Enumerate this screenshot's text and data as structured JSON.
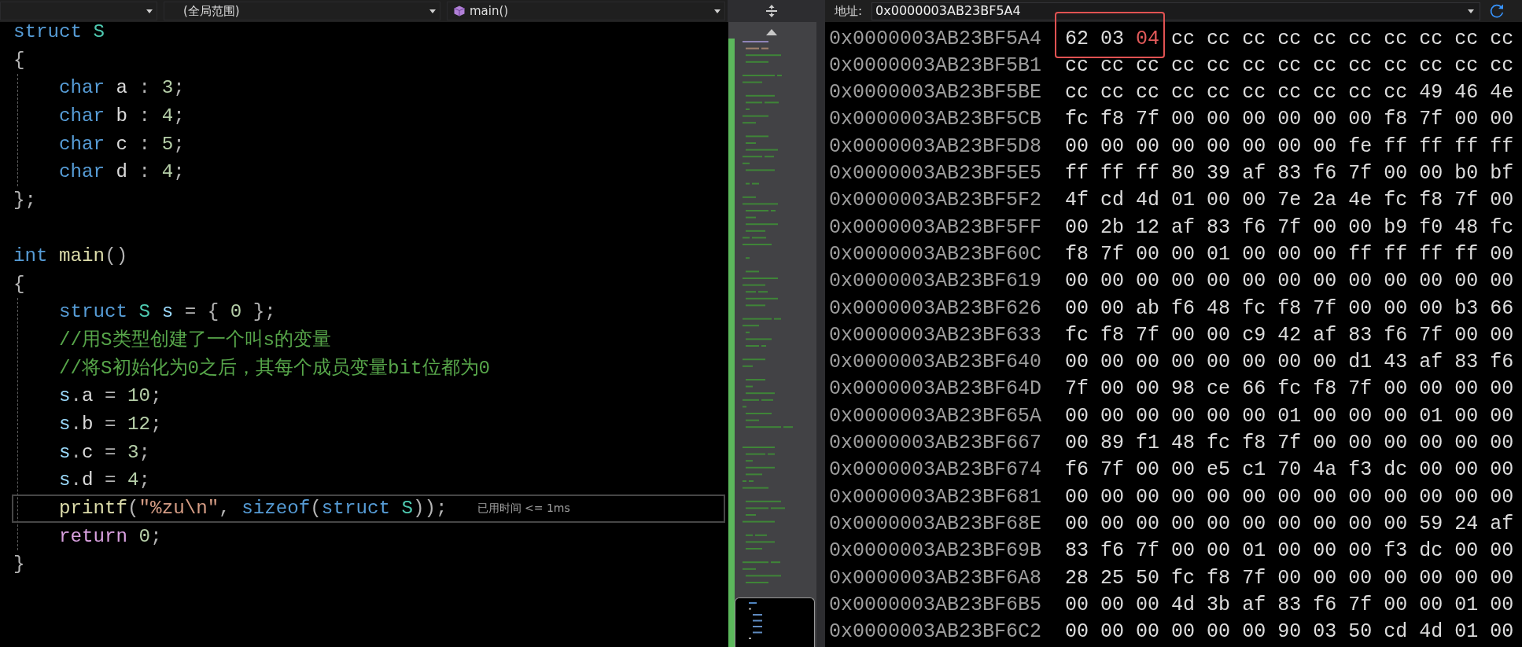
{
  "navigation_bar": {
    "dropdowns": [
      {
        "kind": "plain"
      },
      {
        "kind": "plain",
        "text": "(全局范围)"
      },
      {
        "kind": "function",
        "text": "main()"
      }
    ]
  },
  "editor": {
    "lines": [
      {
        "current": false,
        "tokens": [
          {
            "text": "struct ",
            "kind": "keyword"
          },
          {
            "text": "S",
            "kind": "type"
          }
        ]
      },
      {
        "current": false,
        "tokens": [
          {
            "text": "{",
            "kind": "punct"
          }
        ],
        "children": [
          {
            "current": false,
            "tokens": [
              {
                "text": "char ",
                "kind": "keyword"
              },
              {
                "text": "a",
                "kind": "member"
              },
              {
                "text": " : ",
                "kind": "punct"
              },
              {
                "text": "3",
                "kind": "number"
              },
              {
                "text": ";",
                "kind": "punct"
              }
            ]
          },
          {
            "current": false,
            "tokens": [
              {
                "text": "char ",
                "kind": "keyword"
              },
              {
                "text": "b",
                "kind": "member"
              },
              {
                "text": " : ",
                "kind": "punct"
              },
              {
                "text": "4",
                "kind": "number"
              },
              {
                "text": ";",
                "kind": "punct"
              }
            ]
          },
          {
            "current": false,
            "tokens": [
              {
                "text": "char ",
                "kind": "keyword"
              },
              {
                "text": "c",
                "kind": "member"
              },
              {
                "text": " : ",
                "kind": "punct"
              },
              {
                "text": "5",
                "kind": "number"
              },
              {
                "text": ";",
                "kind": "punct"
              }
            ]
          },
          {
            "current": false,
            "tokens": [
              {
                "text": "char ",
                "kind": "keyword"
              },
              {
                "text": "d",
                "kind": "member"
              },
              {
                "text": " : ",
                "kind": "punct"
              },
              {
                "text": "4",
                "kind": "number"
              },
              {
                "text": ";",
                "kind": "punct"
              }
            ]
          }
        ]
      },
      {
        "current": false,
        "tokens": [
          {
            "text": "};",
            "kind": "punct"
          }
        ]
      },
      {
        "current": false
      },
      {
        "current": false,
        "tokens": [
          {
            "text": "int ",
            "kind": "keyword"
          },
          {
            "text": "main",
            "kind": "function"
          },
          {
            "text": "()",
            "kind": "punct"
          }
        ]
      },
      {
        "current": false,
        "tokens": [
          {
            "text": "{",
            "kind": "punct"
          }
        ],
        "children": [
          {
            "current": false,
            "tokens": [
              {
                "text": "struct ",
                "kind": "keyword"
              },
              {
                "text": "S ",
                "kind": "type"
              },
              {
                "text": "s",
                "kind": "variable"
              },
              {
                "text": " = { ",
                "kind": "punct"
              },
              {
                "text": "0",
                "kind": "number"
              },
              {
                "text": " };",
                "kind": "punct"
              }
            ]
          },
          {
            "current": false,
            "tokens": [
              {
                "text": "//用S类型创建了一个叫s的变量",
                "kind": "comment"
              }
            ]
          },
          {
            "current": false,
            "tokens": [
              {
                "text": "//将S初始化为0之后，其每个成员变量bit位都为0",
                "kind": "comment"
              }
            ]
          },
          {
            "current": false,
            "tokens": [
              {
                "text": "s",
                "kind": "variable"
              },
              {
                "text": ".",
                "kind": "punct"
              },
              {
                "text": "a",
                "kind": "member"
              },
              {
                "text": " = ",
                "kind": "punct"
              },
              {
                "text": "10",
                "kind": "number"
              },
              {
                "text": ";",
                "kind": "punct"
              }
            ]
          },
          {
            "current": false,
            "tokens": [
              {
                "text": "s",
                "kind": "variable"
              },
              {
                "text": ".",
                "kind": "punct"
              },
              {
                "text": "b",
                "kind": "member"
              },
              {
                "text": " = ",
                "kind": "punct"
              },
              {
                "text": "12",
                "kind": "number"
              },
              {
                "text": ";",
                "kind": "punct"
              }
            ]
          },
          {
            "current": false,
            "tokens": [
              {
                "text": "s",
                "kind": "variable"
              },
              {
                "text": ".",
                "kind": "punct"
              },
              {
                "text": "c",
                "kind": "member"
              },
              {
                "text": " = ",
                "kind": "punct"
              },
              {
                "text": "3",
                "kind": "number"
              },
              {
                "text": ";",
                "kind": "punct"
              }
            ]
          },
          {
            "current": false,
            "tokens": [
              {
                "text": "s",
                "kind": "variable"
              },
              {
                "text": ".",
                "kind": "punct"
              },
              {
                "text": "d",
                "kind": "member"
              },
              {
                "text": " = ",
                "kind": "punct"
              },
              {
                "text": "4",
                "kind": "number"
              },
              {
                "text": ";",
                "kind": "punct"
              }
            ]
          },
          {
            "current": true,
            "hint": "已用时间 <= 1ms",
            "tokens": [
              {
                "text": "printf",
                "kind": "function"
              },
              {
                "text": "(",
                "kind": "punct"
              },
              {
                "text": "\"%zu\\n\"",
                "kind": "string"
              },
              {
                "text": ", ",
                "kind": "punct"
              },
              {
                "text": "sizeof",
                "kind": "keyword"
              },
              {
                "text": "(",
                "kind": "punct"
              },
              {
                "text": "struct ",
                "kind": "keyword"
              },
              {
                "text": "S",
                "kind": "type"
              },
              {
                "text": "));",
                "kind": "punct"
              }
            ]
          },
          {
            "current": false,
            "tokens": [
              {
                "text": "return ",
                "kind": "control"
              },
              {
                "text": "0",
                "kind": "number"
              },
              {
                "text": ";",
                "kind": "punct"
              }
            ]
          }
        ]
      },
      {
        "current": false,
        "tokens": [
          {
            "text": "}",
            "kind": "punct"
          }
        ]
      }
    ]
  },
  "memory_window": {
    "address_label": "地址:",
    "address": "0x0000003AB23BF5A4",
    "rows": [
      {
        "address": "0x0000003AB23BF5A4",
        "boxed_bytes": [
          {
            "value": "62",
            "changed": false
          },
          {
            "value": "03",
            "changed": false
          },
          {
            "value": "04",
            "changed": true
          }
        ],
        "bytes": [
          {
            "value": "cc",
            "changed": false
          },
          {
            "value": "cc",
            "changed": false
          },
          {
            "value": "cc",
            "changed": false
          },
          {
            "value": "cc",
            "changed": false
          },
          {
            "value": "cc",
            "changed": false
          },
          {
            "value": "cc",
            "changed": false
          },
          {
            "value": "cc",
            "changed": false
          },
          {
            "value": "cc",
            "changed": false
          },
          {
            "value": "cc",
            "changed": false
          },
          {
            "value": "cc",
            "changed": false
          }
        ]
      },
      {
        "address": "0x0000003AB23BF5B1",
        "bytes": [
          {
            "value": "cc",
            "changed": false
          },
          {
            "value": "cc",
            "changed": false
          },
          {
            "value": "cc",
            "changed": false
          },
          {
            "value": "cc",
            "changed": false
          },
          {
            "value": "cc",
            "changed": false
          },
          {
            "value": "cc",
            "changed": false
          },
          {
            "value": "cc",
            "changed": false
          },
          {
            "value": "cc",
            "changed": false
          },
          {
            "value": "cc",
            "changed": false
          },
          {
            "value": "cc",
            "changed": false
          },
          {
            "value": "cc",
            "changed": false
          },
          {
            "value": "cc",
            "changed": false
          },
          {
            "value": "cc",
            "changed": false
          }
        ]
      },
      {
        "address": "0x0000003AB23BF5BE",
        "bytes": [
          {
            "value": "cc",
            "changed": false
          },
          {
            "value": "cc",
            "changed": false
          },
          {
            "value": "cc",
            "changed": false
          },
          {
            "value": "cc",
            "changed": false
          },
          {
            "value": "cc",
            "changed": false
          },
          {
            "value": "cc",
            "changed": false
          },
          {
            "value": "cc",
            "changed": false
          },
          {
            "value": "cc",
            "changed": false
          },
          {
            "value": "cc",
            "changed": false
          },
          {
            "value": "cc",
            "changed": false
          },
          {
            "value": "49",
            "changed": false
          },
          {
            "value": "46",
            "changed": false
          },
          {
            "value": "4e",
            "changed": false
          }
        ]
      },
      {
        "address": "0x0000003AB23BF5CB",
        "bytes": [
          {
            "value": "fc",
            "changed": false
          },
          {
            "value": "f8",
            "changed": false
          },
          {
            "value": "7f",
            "changed": false
          },
          {
            "value": "00",
            "changed": false
          },
          {
            "value": "00",
            "changed": false
          },
          {
            "value": "00",
            "changed": false
          },
          {
            "value": "00",
            "changed": false
          },
          {
            "value": "00",
            "changed": false
          },
          {
            "value": "00",
            "changed": false
          },
          {
            "value": "f8",
            "changed": false
          },
          {
            "value": "7f",
            "changed": false
          },
          {
            "value": "00",
            "changed": false
          },
          {
            "value": "00",
            "changed": false
          }
        ]
      },
      {
        "address": "0x0000003AB23BF5D8",
        "bytes": [
          {
            "value": "00",
            "changed": false
          },
          {
            "value": "00",
            "changed": false
          },
          {
            "value": "00",
            "changed": false
          },
          {
            "value": "00",
            "changed": false
          },
          {
            "value": "00",
            "changed": false
          },
          {
            "value": "00",
            "changed": false
          },
          {
            "value": "00",
            "changed": false
          },
          {
            "value": "00",
            "changed": false
          },
          {
            "value": "fe",
            "changed": false
          },
          {
            "value": "ff",
            "changed": false
          },
          {
            "value": "ff",
            "changed": false
          },
          {
            "value": "ff",
            "changed": false
          },
          {
            "value": "ff",
            "changed": false
          }
        ]
      },
      {
        "address": "0x0000003AB23BF5E5",
        "bytes": [
          {
            "value": "ff",
            "changed": false
          },
          {
            "value": "ff",
            "changed": false
          },
          {
            "value": "ff",
            "changed": false
          },
          {
            "value": "80",
            "changed": false
          },
          {
            "value": "39",
            "changed": false
          },
          {
            "value": "af",
            "changed": false
          },
          {
            "value": "83",
            "changed": false
          },
          {
            "value": "f6",
            "changed": false
          },
          {
            "value": "7f",
            "changed": false
          },
          {
            "value": "00",
            "changed": false
          },
          {
            "value": "00",
            "changed": false
          },
          {
            "value": "b0",
            "changed": false
          },
          {
            "value": "bf",
            "changed": false
          }
        ]
      },
      {
        "address": "0x0000003AB23BF5F2",
        "bytes": [
          {
            "value": "4f",
            "changed": false
          },
          {
            "value": "cd",
            "changed": false
          },
          {
            "value": "4d",
            "changed": false
          },
          {
            "value": "01",
            "changed": false
          },
          {
            "value": "00",
            "changed": false
          },
          {
            "value": "00",
            "changed": false
          },
          {
            "value": "7e",
            "changed": false
          },
          {
            "value": "2a",
            "changed": false
          },
          {
            "value": "4e",
            "changed": false
          },
          {
            "value": "fc",
            "changed": false
          },
          {
            "value": "f8",
            "changed": false
          },
          {
            "value": "7f",
            "changed": false
          },
          {
            "value": "00",
            "changed": false
          }
        ]
      },
      {
        "address": "0x0000003AB23BF5FF",
        "bytes": [
          {
            "value": "00",
            "changed": false
          },
          {
            "value": "2b",
            "changed": false
          },
          {
            "value": "12",
            "changed": false
          },
          {
            "value": "af",
            "changed": false
          },
          {
            "value": "83",
            "changed": false
          },
          {
            "value": "f6",
            "changed": false
          },
          {
            "value": "7f",
            "changed": false
          },
          {
            "value": "00",
            "changed": false
          },
          {
            "value": "00",
            "changed": false
          },
          {
            "value": "b9",
            "changed": false
          },
          {
            "value": "f0",
            "changed": false
          },
          {
            "value": "48",
            "changed": false
          },
          {
            "value": "fc",
            "changed": false
          }
        ]
      },
      {
        "address": "0x0000003AB23BF60C",
        "bytes": [
          {
            "value": "f8",
            "changed": false
          },
          {
            "value": "7f",
            "changed": false
          },
          {
            "value": "00",
            "changed": false
          },
          {
            "value": "00",
            "changed": false
          },
          {
            "value": "01",
            "changed": false
          },
          {
            "value": "00",
            "changed": false
          },
          {
            "value": "00",
            "changed": false
          },
          {
            "value": "00",
            "changed": false
          },
          {
            "value": "ff",
            "changed": false
          },
          {
            "value": "ff",
            "changed": false
          },
          {
            "value": "ff",
            "changed": false
          },
          {
            "value": "ff",
            "changed": false
          },
          {
            "value": "00",
            "changed": false
          }
        ]
      },
      {
        "address": "0x0000003AB23BF619",
        "bytes": [
          {
            "value": "00",
            "changed": false
          },
          {
            "value": "00",
            "changed": false
          },
          {
            "value": "00",
            "changed": false
          },
          {
            "value": "00",
            "changed": false
          },
          {
            "value": "00",
            "changed": false
          },
          {
            "value": "00",
            "changed": false
          },
          {
            "value": "00",
            "changed": false
          },
          {
            "value": "00",
            "changed": false
          },
          {
            "value": "00",
            "changed": false
          },
          {
            "value": "00",
            "changed": false
          },
          {
            "value": "00",
            "changed": false
          },
          {
            "value": "00",
            "changed": false
          },
          {
            "value": "00",
            "changed": false
          }
        ]
      },
      {
        "address": "0x0000003AB23BF626",
        "bytes": [
          {
            "value": "00",
            "changed": false
          },
          {
            "value": "00",
            "changed": false
          },
          {
            "value": "ab",
            "changed": false
          },
          {
            "value": "f6",
            "changed": false
          },
          {
            "value": "48",
            "changed": false
          },
          {
            "value": "fc",
            "changed": false
          },
          {
            "value": "f8",
            "changed": false
          },
          {
            "value": "7f",
            "changed": false
          },
          {
            "value": "00",
            "changed": false
          },
          {
            "value": "00",
            "changed": false
          },
          {
            "value": "00",
            "changed": false
          },
          {
            "value": "b3",
            "changed": false
          },
          {
            "value": "66",
            "changed": false
          }
        ]
      },
      {
        "address": "0x0000003AB23BF633",
        "bytes": [
          {
            "value": "fc",
            "changed": false
          },
          {
            "value": "f8",
            "changed": false
          },
          {
            "value": "7f",
            "changed": false
          },
          {
            "value": "00",
            "changed": false
          },
          {
            "value": "00",
            "changed": false
          },
          {
            "value": "c9",
            "changed": false
          },
          {
            "value": "42",
            "changed": false
          },
          {
            "value": "af",
            "changed": false
          },
          {
            "value": "83",
            "changed": false
          },
          {
            "value": "f6",
            "changed": false
          },
          {
            "value": "7f",
            "changed": false
          },
          {
            "value": "00",
            "changed": false
          },
          {
            "value": "00",
            "changed": false
          }
        ]
      },
      {
        "address": "0x0000003AB23BF640",
        "bytes": [
          {
            "value": "00",
            "changed": false
          },
          {
            "value": "00",
            "changed": false
          },
          {
            "value": "00",
            "changed": false
          },
          {
            "value": "00",
            "changed": false
          },
          {
            "value": "00",
            "changed": false
          },
          {
            "value": "00",
            "changed": false
          },
          {
            "value": "00",
            "changed": false
          },
          {
            "value": "00",
            "changed": false
          },
          {
            "value": "d1",
            "changed": false
          },
          {
            "value": "43",
            "changed": false
          },
          {
            "value": "af",
            "changed": false
          },
          {
            "value": "83",
            "changed": false
          },
          {
            "value": "f6",
            "changed": false
          }
        ]
      },
      {
        "address": "0x0000003AB23BF64D",
        "bytes": [
          {
            "value": "7f",
            "changed": false
          },
          {
            "value": "00",
            "changed": false
          },
          {
            "value": "00",
            "changed": false
          },
          {
            "value": "98",
            "changed": false
          },
          {
            "value": "ce",
            "changed": false
          },
          {
            "value": "66",
            "changed": false
          },
          {
            "value": "fc",
            "changed": false
          },
          {
            "value": "f8",
            "changed": false
          },
          {
            "value": "7f",
            "changed": false
          },
          {
            "value": "00",
            "changed": false
          },
          {
            "value": "00",
            "changed": false
          },
          {
            "value": "00",
            "changed": false
          },
          {
            "value": "00",
            "changed": false
          }
        ]
      },
      {
        "address": "0x0000003AB23BF65A",
        "bytes": [
          {
            "value": "00",
            "changed": false
          },
          {
            "value": "00",
            "changed": false
          },
          {
            "value": "00",
            "changed": false
          },
          {
            "value": "00",
            "changed": false
          },
          {
            "value": "00",
            "changed": false
          },
          {
            "value": "00",
            "changed": false
          },
          {
            "value": "01",
            "changed": false
          },
          {
            "value": "00",
            "changed": false
          },
          {
            "value": "00",
            "changed": false
          },
          {
            "value": "00",
            "changed": false
          },
          {
            "value": "01",
            "changed": false
          },
          {
            "value": "00",
            "changed": false
          },
          {
            "value": "00",
            "changed": false
          }
        ]
      },
      {
        "address": "0x0000003AB23BF667",
        "bytes": [
          {
            "value": "00",
            "changed": false
          },
          {
            "value": "89",
            "changed": false
          },
          {
            "value": "f1",
            "changed": false
          },
          {
            "value": "48",
            "changed": false
          },
          {
            "value": "fc",
            "changed": false
          },
          {
            "value": "f8",
            "changed": false
          },
          {
            "value": "7f",
            "changed": false
          },
          {
            "value": "00",
            "changed": false
          },
          {
            "value": "00",
            "changed": false
          },
          {
            "value": "00",
            "changed": false
          },
          {
            "value": "00",
            "changed": false
          },
          {
            "value": "00",
            "changed": false
          },
          {
            "value": "00",
            "changed": false
          }
        ]
      },
      {
        "address": "0x0000003AB23BF674",
        "bytes": [
          {
            "value": "f6",
            "changed": false
          },
          {
            "value": "7f",
            "changed": false
          },
          {
            "value": "00",
            "changed": false
          },
          {
            "value": "00",
            "changed": false
          },
          {
            "value": "e5",
            "changed": false
          },
          {
            "value": "c1",
            "changed": false
          },
          {
            "value": "70",
            "changed": false
          },
          {
            "value": "4a",
            "changed": false
          },
          {
            "value": "f3",
            "changed": false
          },
          {
            "value": "dc",
            "changed": false
          },
          {
            "value": "00",
            "changed": false
          },
          {
            "value": "00",
            "changed": false
          },
          {
            "value": "00",
            "changed": false
          }
        ]
      },
      {
        "address": "0x0000003AB23BF681",
        "bytes": [
          {
            "value": "00",
            "changed": false
          },
          {
            "value": "00",
            "changed": false
          },
          {
            "value": "00",
            "changed": false
          },
          {
            "value": "00",
            "changed": false
          },
          {
            "value": "00",
            "changed": false
          },
          {
            "value": "00",
            "changed": false
          },
          {
            "value": "00",
            "changed": false
          },
          {
            "value": "00",
            "changed": false
          },
          {
            "value": "00",
            "changed": false
          },
          {
            "value": "00",
            "changed": false
          },
          {
            "value": "00",
            "changed": false
          },
          {
            "value": "00",
            "changed": false
          },
          {
            "value": "00",
            "changed": false
          }
        ]
      },
      {
        "address": "0x0000003AB23BF68E",
        "bytes": [
          {
            "value": "00",
            "changed": false
          },
          {
            "value": "00",
            "changed": false
          },
          {
            "value": "00",
            "changed": false
          },
          {
            "value": "00",
            "changed": false
          },
          {
            "value": "00",
            "changed": false
          },
          {
            "value": "00",
            "changed": false
          },
          {
            "value": "00",
            "changed": false
          },
          {
            "value": "00",
            "changed": false
          },
          {
            "value": "00",
            "changed": false
          },
          {
            "value": "00",
            "changed": false
          },
          {
            "value": "59",
            "changed": false
          },
          {
            "value": "24",
            "changed": false
          },
          {
            "value": "af",
            "changed": false
          }
        ]
      },
      {
        "address": "0x0000003AB23BF69B",
        "bytes": [
          {
            "value": "83",
            "changed": false
          },
          {
            "value": "f6",
            "changed": false
          },
          {
            "value": "7f",
            "changed": false
          },
          {
            "value": "00",
            "changed": false
          },
          {
            "value": "00",
            "changed": false
          },
          {
            "value": "01",
            "changed": false
          },
          {
            "value": "00",
            "changed": false
          },
          {
            "value": "00",
            "changed": false
          },
          {
            "value": "00",
            "changed": false
          },
          {
            "value": "f3",
            "changed": false
          },
          {
            "value": "dc",
            "changed": false
          },
          {
            "value": "00",
            "changed": false
          },
          {
            "value": "00",
            "changed": false
          }
        ]
      },
      {
        "address": "0x0000003AB23BF6A8",
        "bytes": [
          {
            "value": "28",
            "changed": false
          },
          {
            "value": "25",
            "changed": false
          },
          {
            "value": "50",
            "changed": false
          },
          {
            "value": "fc",
            "changed": false
          },
          {
            "value": "f8",
            "changed": false
          },
          {
            "value": "7f",
            "changed": false
          },
          {
            "value": "00",
            "changed": false
          },
          {
            "value": "00",
            "changed": false
          },
          {
            "value": "00",
            "changed": false
          },
          {
            "value": "00",
            "changed": false
          },
          {
            "value": "00",
            "changed": false
          },
          {
            "value": "00",
            "changed": false
          },
          {
            "value": "00",
            "changed": false
          }
        ]
      },
      {
        "address": "0x0000003AB23BF6B5",
        "bytes": [
          {
            "value": "00",
            "changed": false
          },
          {
            "value": "00",
            "changed": false
          },
          {
            "value": "00",
            "changed": false
          },
          {
            "value": "4d",
            "changed": false
          },
          {
            "value": "3b",
            "changed": false
          },
          {
            "value": "af",
            "changed": false
          },
          {
            "value": "83",
            "changed": false
          },
          {
            "value": "f6",
            "changed": false
          },
          {
            "value": "7f",
            "changed": false
          },
          {
            "value": "00",
            "changed": false
          },
          {
            "value": "00",
            "changed": false
          },
          {
            "value": "01",
            "changed": false
          },
          {
            "value": "00",
            "changed": false
          }
        ]
      },
      {
        "address": "0x0000003AB23BF6C2",
        "bytes": [
          {
            "value": "00",
            "changed": false
          },
          {
            "value": "00",
            "changed": false
          },
          {
            "value": "00",
            "changed": false
          },
          {
            "value": "00",
            "changed": false
          },
          {
            "value": "00",
            "changed": false
          },
          {
            "value": "00",
            "changed": false
          },
          {
            "value": "90",
            "changed": false
          },
          {
            "value": "03",
            "changed": false
          },
          {
            "value": "50",
            "changed": false
          },
          {
            "value": "cd",
            "changed": false
          },
          {
            "value": "4d",
            "changed": false
          },
          {
            "value": "01",
            "changed": false
          },
          {
            "value": "00",
            "changed": false
          }
        ]
      }
    ]
  }
}
